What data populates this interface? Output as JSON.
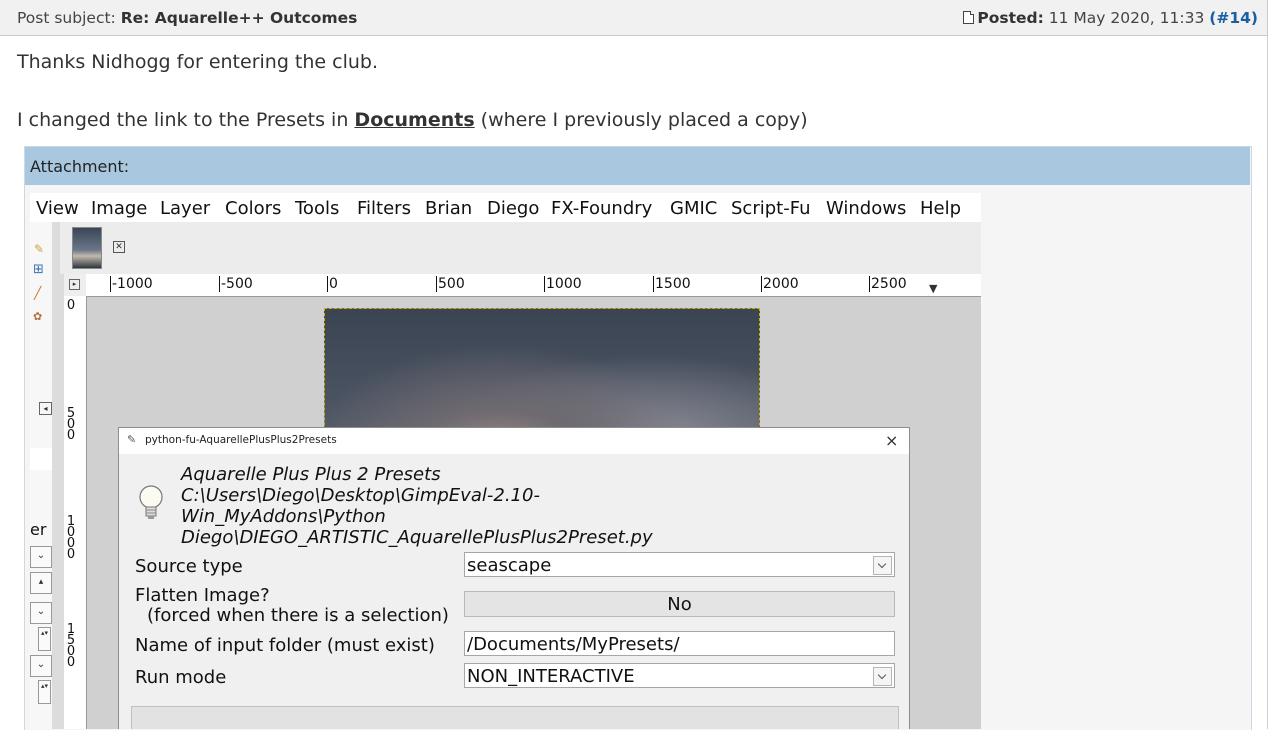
{
  "post": {
    "subject_label": "Post subject:",
    "subject": "Re: Aquarelle++ Outcomes",
    "posted_label": "Posted:",
    "posted_date": "11 May 2020, 11:33",
    "post_number": "(#14)",
    "para1": "Thanks Nidhogg for entering the club.",
    "para2_before": "I changed the link to the Presets in ",
    "para2_link": "Documents",
    "para2_after": " (where I previously placed a copy)"
  },
  "attachment": {
    "label": "Attachment:"
  },
  "gimp": {
    "menu": [
      "View",
      "Image",
      "Layer",
      "Colors",
      "Tools",
      "Filters",
      "Brian",
      "Diego",
      "FX-Foundry",
      "GMIC",
      "Script-Fu",
      "Windows",
      "Help"
    ],
    "ruler_h": [
      "-1000",
      "-500",
      "0",
      "500",
      "1000",
      "1500",
      "2000",
      "2500"
    ],
    "ruler_v": [
      "0",
      "500",
      "1000",
      "1500"
    ],
    "side_text": "er"
  },
  "dialog": {
    "title": "python-fu-AquarellePlusPlus2Presets",
    "close": "×",
    "heading": "Aquarelle Plus Plus 2 Presets\nC:\\Users\\Diego\\Desktop\\GimpEval-2.10-\nWin_MyAddons\\Python\nDiego\\DIEGO_ARTISTIC_AquarellePlusPlus2Preset.py",
    "source_type_label": "Source type",
    "source_type_value": "seascape",
    "flatten_label": "Flatten Image?",
    "flatten_sub": "(forced when there is a selection)",
    "flatten_value": "No",
    "folder_label": "Name of input folder (must exist)",
    "folder_value": "/Documents/MyPresets/",
    "run_mode_label": "Run mode",
    "run_mode_value": "NON_INTERACTIVE"
  },
  "colors": {
    "link": "#1a5fa0",
    "attachment_header": "#a9c8df",
    "post_header_bg": "#f1f1f1"
  }
}
